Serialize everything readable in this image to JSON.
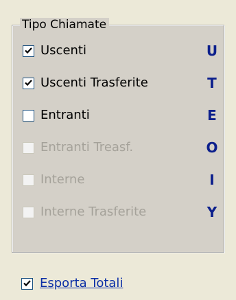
{
  "group": {
    "title": "Tipo Chiamate",
    "items": [
      {
        "label": "Uscenti",
        "code": "U",
        "checked": true,
        "enabled": true
      },
      {
        "label": "Uscenti Trasferite",
        "code": "T",
        "checked": true,
        "enabled": true
      },
      {
        "label": "Entranti",
        "code": "E",
        "checked": false,
        "enabled": true
      },
      {
        "label": "Entranti Treasf.",
        "code": "O",
        "checked": false,
        "enabled": false
      },
      {
        "label": "Interne",
        "code": "I",
        "checked": false,
        "enabled": false
      },
      {
        "label": "Interne Trasferite",
        "code": "Y",
        "checked": false,
        "enabled": false
      }
    ]
  },
  "export": {
    "label": "Esporta Totali",
    "checked": true
  },
  "colors": {
    "background": "#ece9d8",
    "group_background": "#d4d0c8",
    "code_color": "#0c1f8c",
    "link_color": "#0c2fa6",
    "disabled_text": "#a5a29a"
  }
}
